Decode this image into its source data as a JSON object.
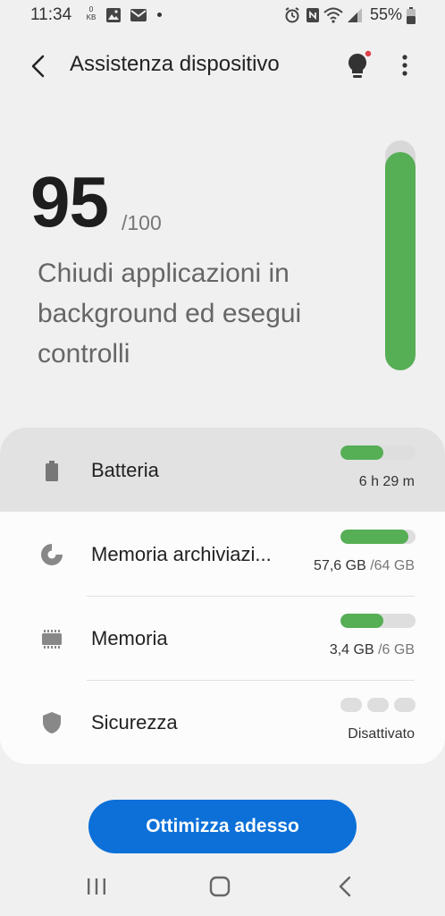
{
  "status_bar": {
    "time": "11:34",
    "data_rate_value": "0",
    "data_rate_unit": "KB",
    "battery_percent": "55%",
    "icons": [
      "image-icon",
      "mail-icon",
      "alarm-icon",
      "nfc-icon",
      "wifi-icon",
      "signal-icon",
      "battery-icon"
    ]
  },
  "app_bar": {
    "title": "Assistenza dispositivo"
  },
  "score": {
    "value": "95",
    "max": "/100",
    "description": "Chiudi applicazioni in background ed esegui controlli",
    "fill_fraction": 0.95,
    "color": "#56ae55"
  },
  "items": [
    {
      "label": "Batteria",
      "value": "6 h 29 m",
      "value_dim": "",
      "fill_fraction": 0.57,
      "icon": "battery-icon"
    },
    {
      "label": "Memoria archiviazi...",
      "value": "57,6 GB",
      "value_dim": " /64 GB",
      "fill_fraction": 0.9,
      "icon": "storage-pie-icon"
    },
    {
      "label": "Memoria",
      "value": "3,4 GB",
      "value_dim": " /6 GB",
      "fill_fraction": 0.57,
      "icon": "memory-chip-icon"
    },
    {
      "label": "Sicurezza",
      "value": "Disattivato",
      "value_dim": "",
      "icon": "shield-icon"
    }
  ],
  "optimize_button": {
    "label": "Ottimizza adesso",
    "color": "#0c70d8"
  },
  "accent_green": "#56ae55"
}
